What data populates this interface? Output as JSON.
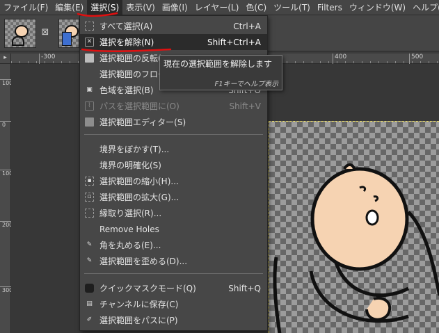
{
  "menubar": {
    "items": [
      {
        "label": "ファイル(F)"
      },
      {
        "label": "編集(E)"
      },
      {
        "label": "選択(S)"
      },
      {
        "label": "表示(V)"
      },
      {
        "label": "画像(I)"
      },
      {
        "label": "レイヤー(L)"
      },
      {
        "label": "色(C)"
      },
      {
        "label": "ツール(T)"
      },
      {
        "label": "Filters"
      },
      {
        "label": "ウィンドウ(W)"
      },
      {
        "label": "ヘルプ(H)"
      }
    ],
    "active_index": 2
  },
  "tabs": {
    "close_glyph": "⊠",
    "images": [
      {
        "icon": "image-thumbnail-icon"
      },
      {
        "icon": "image-thumbnail-icon"
      }
    ]
  },
  "ruler": {
    "corner_glyph": "▸",
    "h_ticks": [
      "-300",
      "400",
      "500"
    ],
    "v_ticks": [
      "100",
      "0",
      "100",
      "200",
      "300"
    ]
  },
  "select_menu": {
    "items": [
      {
        "label": "すべて選択(A)",
        "shortcut": "Ctrl+A",
        "icon": "select-all-icon",
        "state": "normal"
      },
      {
        "label": "選択を解除(N)",
        "shortcut": "Shift+Ctrl+A",
        "icon": "select-none-icon",
        "state": "highlighted"
      },
      {
        "label": "選択範囲の反転(",
        "shortcut": "",
        "icon": "invert-selection-icon",
        "state": "normal"
      },
      {
        "label": "選択範囲のフロー",
        "shortcut": "",
        "icon": "",
        "state": "normal"
      },
      {
        "label": "色域を選択(B)",
        "shortcut": "Shift+O",
        "icon": "select-by-color-icon",
        "state": "normal"
      },
      {
        "label": "パスを選択範囲に(O)",
        "shortcut": "Shift+V",
        "icon": "path-to-selection-icon",
        "state": "disabled"
      },
      {
        "label": "選択範囲エディター(S)",
        "shortcut": "",
        "icon": "selection-editor-icon",
        "state": "normal"
      },
      {
        "label": "境界をぼかす(T)...",
        "shortcut": "",
        "icon": "",
        "state": "normal"
      },
      {
        "label": "境界の明確化(S)",
        "shortcut": "",
        "icon": "",
        "state": "normal"
      },
      {
        "label": "選択範囲の縮小(H)...",
        "shortcut": "",
        "icon": "shrink-selection-icon",
        "state": "normal"
      },
      {
        "label": "選択範囲の拡大(G)...",
        "shortcut": "",
        "icon": "grow-selection-icon",
        "state": "normal"
      },
      {
        "label": "縁取り選択(R)...",
        "shortcut": "",
        "icon": "border-selection-icon",
        "state": "normal"
      },
      {
        "label": "Remove Holes",
        "shortcut": "",
        "icon": "",
        "state": "normal"
      },
      {
        "label": "角を丸める(E)...",
        "shortcut": "",
        "icon": "rounded-corners-icon",
        "state": "normal"
      },
      {
        "label": "選択範囲を歪める(D)...",
        "shortcut": "",
        "icon": "distort-selection-icon",
        "state": "normal"
      },
      {
        "label": "クイックマスクモード(Q)",
        "shortcut": "Shift+Q",
        "icon": "quick-mask-icon",
        "state": "normal"
      },
      {
        "label": "チャンネルに保存(C)",
        "shortcut": "",
        "icon": "save-to-channel-icon",
        "state": "normal"
      },
      {
        "label": "選択範囲をパスに(P)",
        "shortcut": "",
        "icon": "selection-to-path-icon",
        "state": "normal"
      }
    ]
  },
  "tooltip": {
    "text": "現在の選択範囲を解除します",
    "help": "F1キーでヘルプ表示"
  },
  "colors": {
    "annotation_red": "#e01010",
    "selection_marquee": "#f0e060",
    "skin": "#f6d3b2"
  }
}
